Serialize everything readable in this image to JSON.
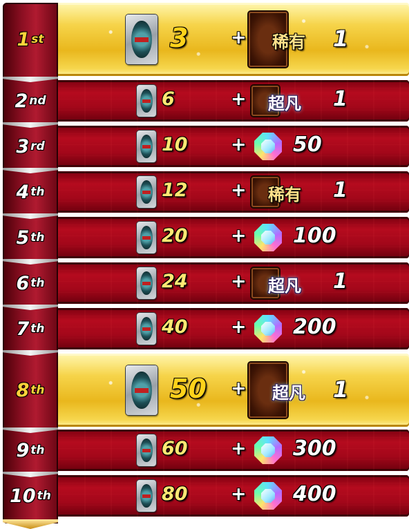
{
  "title": "",
  "colors": {
    "gold_row": "#f6d44a",
    "red_row": "#a3071a",
    "rank_gold_text": "#ffd23a",
    "count_text": "#ffe873"
  },
  "icons": {
    "pack": "card-pack-icon",
    "card": "card-back-icon",
    "gem": "gem-icon"
  },
  "rows": [
    {
      "rank_num": "1",
      "rank_suffix": "st",
      "count": "3",
      "plus": "+",
      "reward_type": "card",
      "reward_label": "稀有",
      "reward_value": "1",
      "highlight": true
    },
    {
      "rank_num": "2",
      "rank_suffix": "nd",
      "count": "6",
      "plus": "+",
      "reward_type": "card",
      "reward_label": "超凡",
      "reward_value": "1",
      "highlight": false
    },
    {
      "rank_num": "3",
      "rank_suffix": "rd",
      "count": "10",
      "plus": "+",
      "reward_type": "gem",
      "reward_label": "",
      "reward_value": "50",
      "highlight": false
    },
    {
      "rank_num": "4",
      "rank_suffix": "th",
      "count": "12",
      "plus": "+",
      "reward_type": "card",
      "reward_label": "稀有",
      "reward_value": "1",
      "highlight": false
    },
    {
      "rank_num": "5",
      "rank_suffix": "th",
      "count": "20",
      "plus": "+",
      "reward_type": "gem",
      "reward_label": "",
      "reward_value": "100",
      "highlight": false
    },
    {
      "rank_num": "6",
      "rank_suffix": "th",
      "count": "24",
      "plus": "+",
      "reward_type": "card",
      "reward_label": "超凡",
      "reward_value": "1",
      "highlight": false
    },
    {
      "rank_num": "7",
      "rank_suffix": "th",
      "count": "40",
      "plus": "+",
      "reward_type": "gem",
      "reward_label": "",
      "reward_value": "200",
      "highlight": false
    },
    {
      "rank_num": "8",
      "rank_suffix": "th",
      "count": "50",
      "plus": "+",
      "reward_type": "card",
      "reward_label": "超凡",
      "reward_value": "1",
      "highlight": true
    },
    {
      "rank_num": "9",
      "rank_suffix": "th",
      "count": "60",
      "plus": "+",
      "reward_type": "gem",
      "reward_label": "",
      "reward_value": "300",
      "highlight": false
    },
    {
      "rank_num": "10",
      "rank_suffix": "th",
      "count": "80",
      "plus": "+",
      "reward_type": "gem",
      "reward_label": "",
      "reward_value": "400",
      "highlight": false
    }
  ]
}
